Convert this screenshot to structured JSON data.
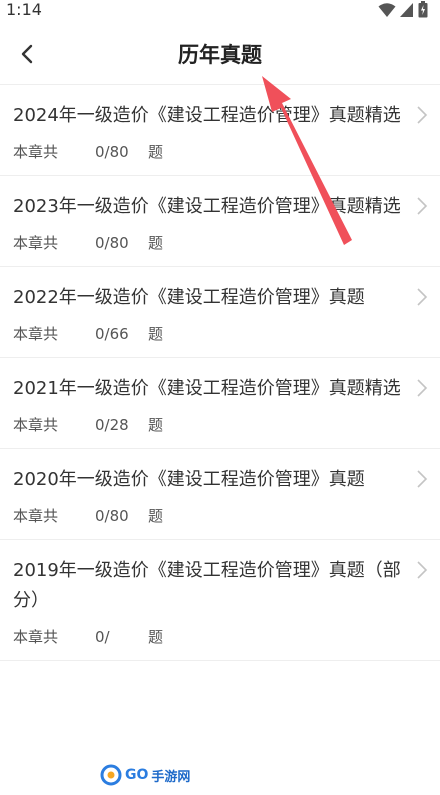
{
  "status": {
    "time": "1:14"
  },
  "nav": {
    "title": "历年真题"
  },
  "items": [
    {
      "title": "2024年一级造价《建设工程造价管理》真题精选",
      "prefix": "本章共",
      "count": "0/80",
      "suffix": "题"
    },
    {
      "title": "2023年一级造价《建设工程造价管理》真题精选",
      "prefix": "本章共",
      "count": "0/80",
      "suffix": "题"
    },
    {
      "title": "2022年一级造价《建设工程造价管理》真题",
      "prefix": "本章共",
      "count": "0/66",
      "suffix": "题"
    },
    {
      "title": "2021年一级造价《建设工程造价管理》真题精选",
      "prefix": "本章共",
      "count": "0/28",
      "suffix": "题"
    },
    {
      "title": "2020年一级造价《建设工程造价管理》真题",
      "prefix": "本章共",
      "count": "0/80",
      "suffix": "题"
    },
    {
      "title": "2019年一级造价《建设工程造价管理》真题（部分）",
      "prefix": "本章共",
      "count": "0/",
      "suffix": "题"
    }
  ],
  "watermark": {
    "text": "GO",
    "text2": "手游网"
  },
  "colors": {
    "annotation_arrow": "#f0505a",
    "divider": "#eeeeee"
  }
}
